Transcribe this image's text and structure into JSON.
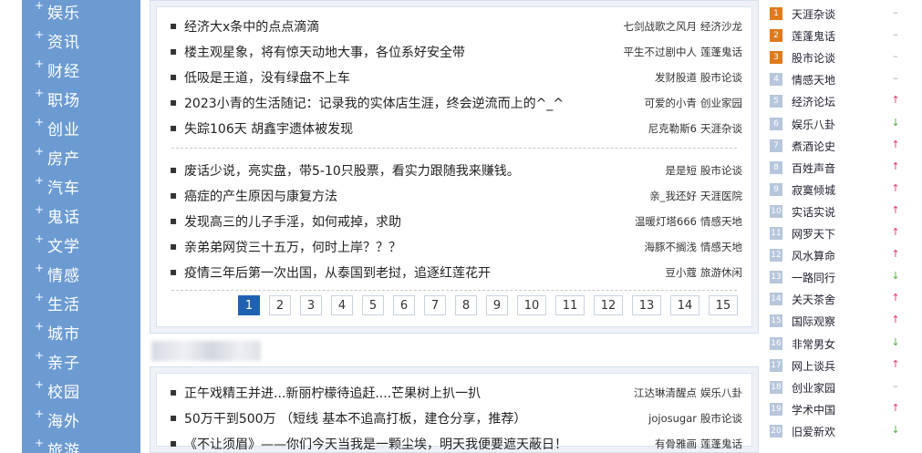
{
  "sidebar": {
    "plus_glyph": "+",
    "items": [
      "娱乐",
      "资讯",
      "财经",
      "职场",
      "创业",
      "房产",
      "汽车",
      "鬼话",
      "文学",
      "情感",
      "生活",
      "城市",
      "亲子",
      "校园",
      "海外",
      "旅游"
    ]
  },
  "bullet_glyph": "▪",
  "panel1": {
    "group1": [
      {
        "title": "经济大x条中的点点滴滴",
        "author": "七剑战歌之风月",
        "board": "经济沙龙"
      },
      {
        "title": "楼主观星象，将有惊天动地大事，各位系好安全带",
        "author": "平生不过剧中人",
        "board": "莲蓬鬼话"
      },
      {
        "title": "低吸是王道，没有绿盘不上车",
        "author": "发财股道",
        "board": "股市论谈"
      },
      {
        "title": "2023小青的生活随记：记录我的实体店生涯，终会逆流而上的^_^",
        "author": "可爱的小青",
        "board": "创业家园"
      },
      {
        "title": "失踪106天 胡鑫宇遗体被发现",
        "author": "尼克勒斯6",
        "board": "天涯杂谈"
      }
    ],
    "group2": [
      {
        "title": "废话少说，亮实盘，带5-10只股票，看实力跟随我来赚钱。",
        "author": "是是短",
        "board": "股市论谈"
      },
      {
        "title": "癌症的产生原因与康复方法",
        "author": "亲_我还好",
        "board": "天涯医院"
      },
      {
        "title": "发现高三的儿子手淫，如何戒掉，求助",
        "author": "温暖灯塔666",
        "board": "情感天地"
      },
      {
        "title": "亲弟弟网贷三十五万，何时上岸？？？",
        "author": "海豚不搁浅",
        "board": "情感天地"
      },
      {
        "title": "疫情三年后第一次出国，从泰国到老挝，追逐红莲花开",
        "author": "豆小蔻",
        "board": "旅游休闲"
      }
    ],
    "pager": {
      "active": "1",
      "pages": [
        "1",
        "2",
        "3",
        "4",
        "5",
        "6",
        "7",
        "8",
        "9",
        "10",
        "11",
        "12",
        "13",
        "14",
        "15"
      ]
    }
  },
  "panel2": {
    "items": [
      {
        "title": "正午戏精王并进...新丽柠檬待追赶....芒果树上扒一扒",
        "author": "江达琳清醒点",
        "board": "娱乐八卦"
      },
      {
        "title": "50万干到500万 （短线 基本不追高打板，建仓分享，推荐）",
        "author": "jojosugar",
        "board": "股市论谈"
      },
      {
        "title": "《不让须眉》——你们今天当我是一颗尘埃，明天我便要遮天蔽日！",
        "author": "有骨雅画",
        "board": "莲蓬鬼话"
      }
    ]
  },
  "rank": {
    "items": [
      {
        "num": "1",
        "name": "天涯杂谈",
        "trend": "–",
        "trend_type": "flat"
      },
      {
        "num": "2",
        "name": "莲蓬鬼话",
        "trend": "–",
        "trend_type": "flat"
      },
      {
        "num": "3",
        "name": "股市论谈",
        "trend": "–",
        "trend_type": "flat"
      },
      {
        "num": "4",
        "name": "情感天地",
        "trend": "–",
        "trend_type": "flat"
      },
      {
        "num": "5",
        "name": "经济论坛",
        "trend": "↑",
        "trend_type": "up"
      },
      {
        "num": "6",
        "name": "娱乐八卦",
        "trend": "↓",
        "trend_type": "down"
      },
      {
        "num": "7",
        "name": "煮酒论史",
        "trend": "↑",
        "trend_type": "up"
      },
      {
        "num": "8",
        "name": "百姓声音",
        "trend": "↑",
        "trend_type": "up"
      },
      {
        "num": "9",
        "name": "寂寞倾城",
        "trend": "↑",
        "trend_type": "up"
      },
      {
        "num": "10",
        "name": "实话实说",
        "trend": "↑",
        "trend_type": "up"
      },
      {
        "num": "11",
        "name": "网罗天下",
        "trend": "↑",
        "trend_type": "up"
      },
      {
        "num": "12",
        "name": "风水算命",
        "trend": "↑",
        "trend_type": "up"
      },
      {
        "num": "13",
        "name": "一路同行",
        "trend": "↓",
        "trend_type": "down"
      },
      {
        "num": "14",
        "name": "关天茶舍",
        "trend": "↑",
        "trend_type": "up"
      },
      {
        "num": "15",
        "name": "国际观察",
        "trend": "↑",
        "trend_type": "up"
      },
      {
        "num": "16",
        "name": "非常男女",
        "trend": "↓",
        "trend_type": "down"
      },
      {
        "num": "17",
        "name": "网上谈兵",
        "trend": "↑",
        "trend_type": "up"
      },
      {
        "num": "18",
        "name": "创业家园",
        "trend": "–",
        "trend_type": "flat"
      },
      {
        "num": "19",
        "name": "学术中国",
        "trend": "↑",
        "trend_type": "up"
      },
      {
        "num": "20",
        "name": "旧爱新欢",
        "trend": "↓",
        "trend_type": "down"
      }
    ]
  }
}
